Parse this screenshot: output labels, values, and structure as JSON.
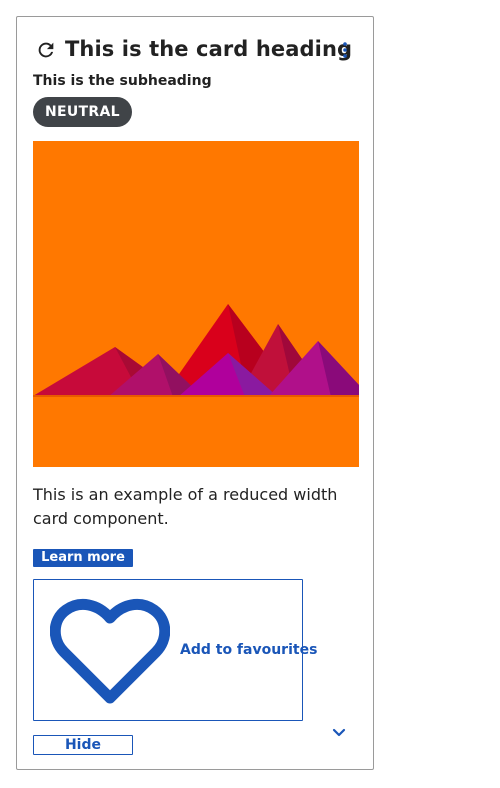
{
  "card": {
    "heading": "This is the card heading",
    "subheading": "This is the subheading",
    "badge": "NEUTRAL",
    "description": "This is an example of a reduced width card component.",
    "learn_more_label": "Learn more",
    "favourite_label": "Add to favourites",
    "hide_label": "Hide"
  },
  "icons": {
    "refresh": "refresh-icon",
    "more": "more-vertical-icon",
    "heart": "heart-outline-icon",
    "chevron": "chevron-down-icon"
  },
  "colors": {
    "accent": "#1a56b8",
    "badge_bg": "#404448",
    "image_bg": "#ff7800"
  }
}
